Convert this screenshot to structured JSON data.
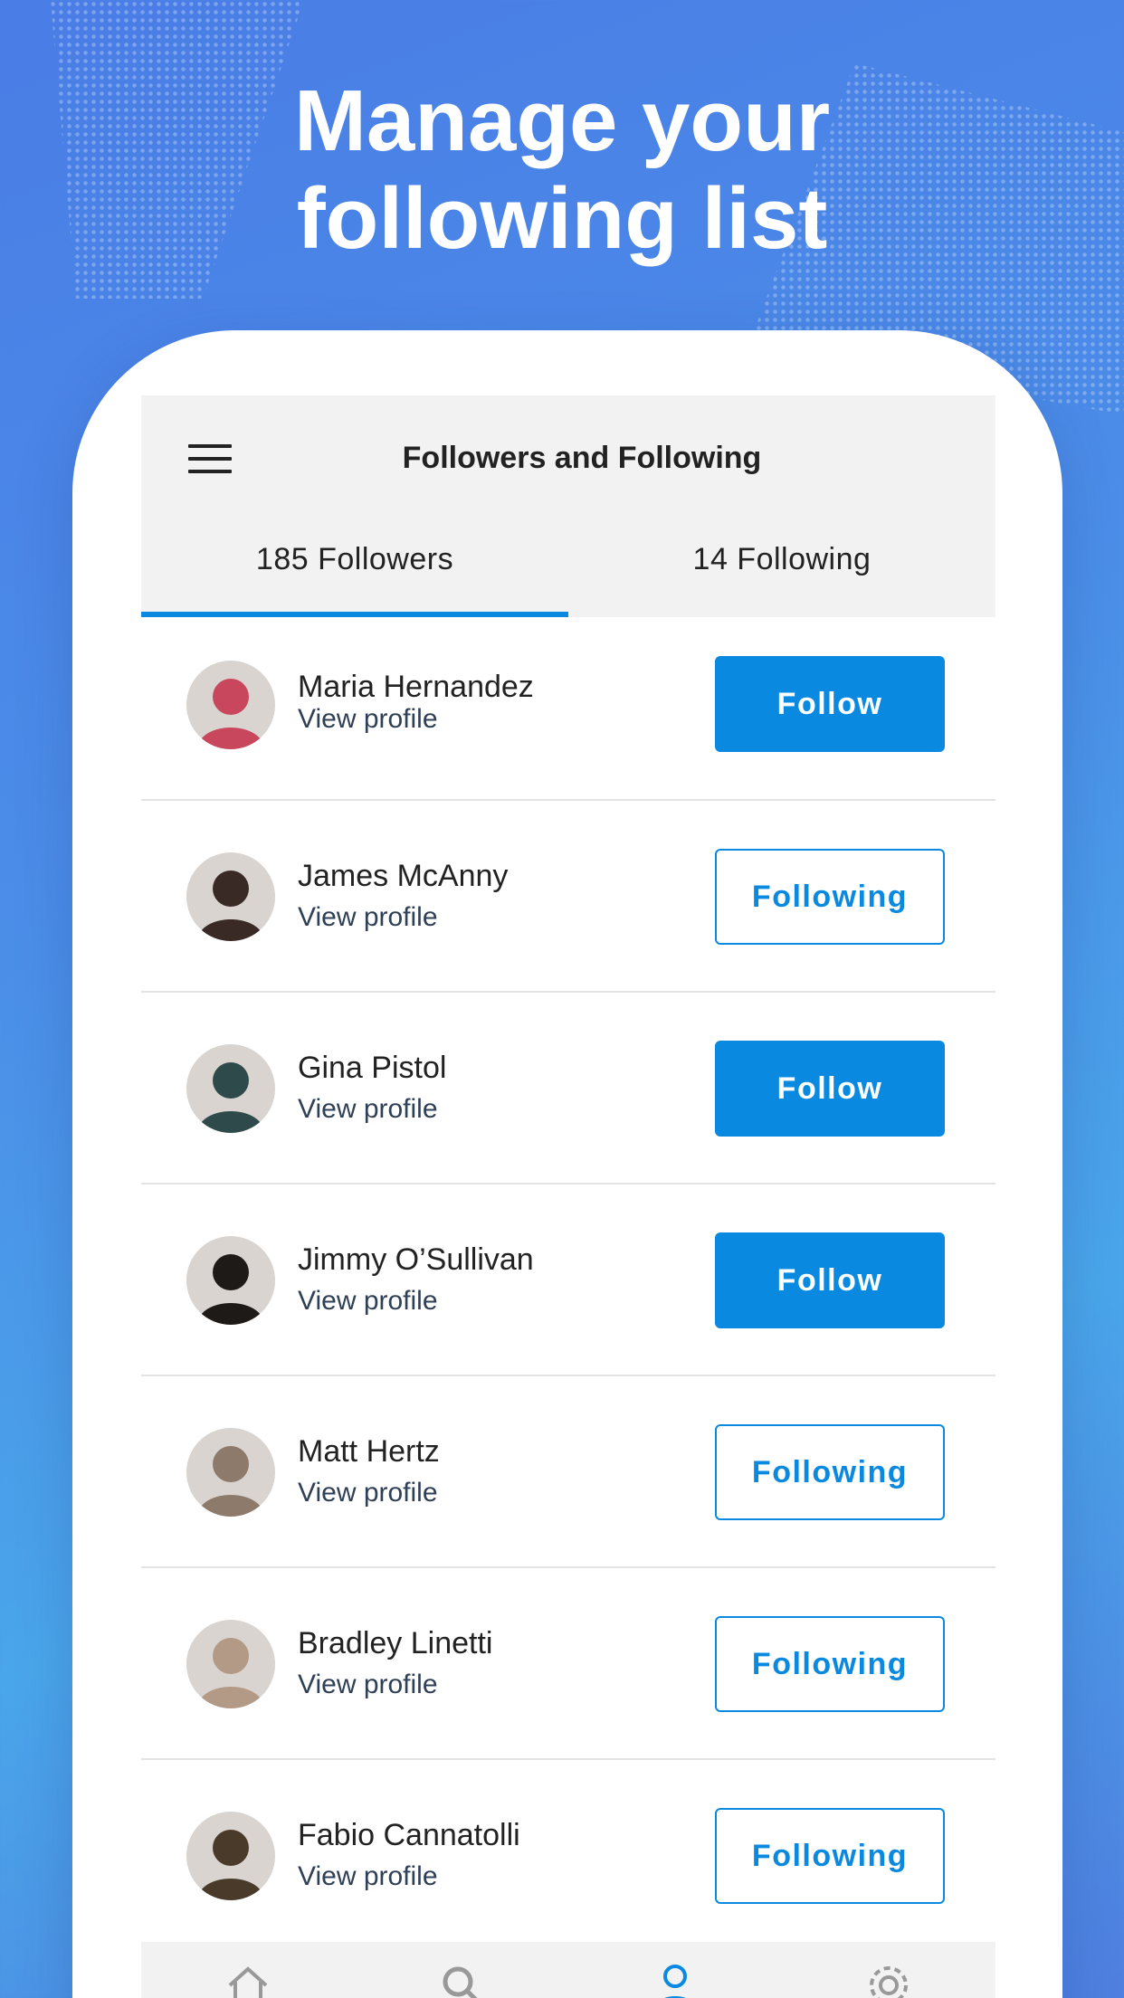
{
  "headline": {
    "line1": "Manage your",
    "line2": "following list"
  },
  "appbar": {
    "title": "Followers and Following",
    "menu_icon": "hamburger-icon"
  },
  "tabs": [
    {
      "label": "185 Followers",
      "active": true
    },
    {
      "label": "14 Following",
      "active": false
    }
  ],
  "people": [
    {
      "name": "Maria Hernandez",
      "link": "View profile",
      "button": "Follow",
      "state": "follow",
      "avatar_color": "#c8475c"
    },
    {
      "name": "James McAnny",
      "link": "View profile",
      "button": "Following",
      "state": "following",
      "avatar_color": "#3a2a26"
    },
    {
      "name": "Gina Pistol",
      "link": "View profile",
      "button": "Follow",
      "state": "follow",
      "avatar_color": "#2f4a4a"
    },
    {
      "name": "Jimmy O’Sullivan",
      "link": "View profile",
      "button": "Follow",
      "state": "follow",
      "avatar_color": "#1d1a18"
    },
    {
      "name": "Matt Hertz",
      "link": "View profile",
      "button": "Following",
      "state": "following",
      "avatar_color": "#8d7a6b"
    },
    {
      "name": "Bradley Linetti",
      "link": "View profile",
      "button": "Following",
      "state": "following",
      "avatar_color": "#b39a86"
    },
    {
      "name": "Fabio Cannatolli",
      "link": "View profile",
      "button": "Following",
      "state": "following",
      "avatar_color": "#4a3a2a"
    }
  ],
  "bottom_nav": [
    {
      "icon": "home-icon",
      "active": false
    },
    {
      "icon": "search-icon",
      "active": false
    },
    {
      "icon": "profile-icon",
      "active": true
    },
    {
      "icon": "settings-icon",
      "active": false
    }
  ],
  "colors": {
    "accent": "#0a89e0",
    "background": "#4a8ee8"
  }
}
